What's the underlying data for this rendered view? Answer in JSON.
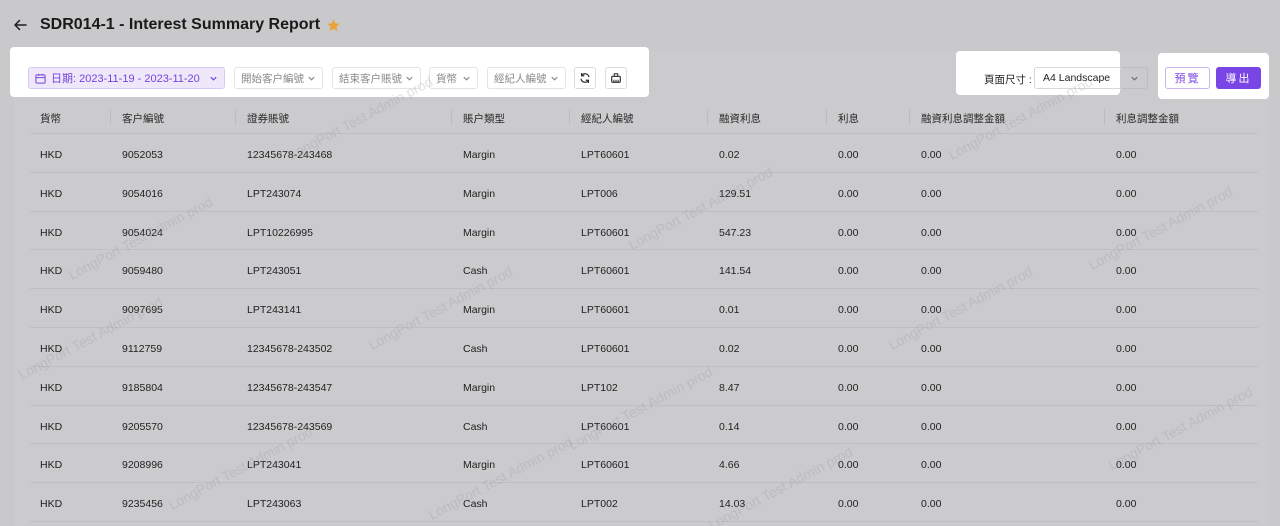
{
  "header": {
    "title": "SDR014-1 - Interest Summary Report"
  },
  "filters": {
    "date_range": "日期: 2023-11-19 - 2023-11-20",
    "start_customer": "開始客户編號",
    "end_customer": "結束客户賬號",
    "currency": "貨幣",
    "broker": "經紀人編號"
  },
  "page_size": {
    "label": "頁面尺寸 :",
    "value": "A4 Landscape"
  },
  "actions": {
    "preview": "預覽",
    "export": "導出"
  },
  "colors": {
    "accent": "#7a45e5",
    "star": "#e8a33a"
  },
  "watermark_text": "LongPort Test Admin prod",
  "table": {
    "columns": [
      "貨幣",
      "客户編號",
      "證券賬號",
      "賬户類型",
      "經紀人編號",
      "融資利息",
      "利息",
      "融資利息調整金額",
      "利息調整金額"
    ],
    "rows": [
      [
        "HKD",
        "9052053",
        "12345678-243468",
        "Margin",
        "LPT60601",
        "0.02",
        "0.00",
        "0.00",
        "0.00"
      ],
      [
        "HKD",
        "9054016",
        "LPT243074",
        "Margin",
        "LPT006",
        "129.51",
        "0.00",
        "0.00",
        "0.00"
      ],
      [
        "HKD",
        "9054024",
        "LPT10226995",
        "Margin",
        "LPT60601",
        "547.23",
        "0.00",
        "0.00",
        "0.00"
      ],
      [
        "HKD",
        "9059480",
        "LPT243051",
        "Cash",
        "LPT60601",
        "141.54",
        "0.00",
        "0.00",
        "0.00"
      ],
      [
        "HKD",
        "9097695",
        "LPT243141",
        "Margin",
        "LPT60601",
        "0.01",
        "0.00",
        "0.00",
        "0.00"
      ],
      [
        "HKD",
        "9112759",
        "12345678-243502",
        "Cash",
        "LPT60601",
        "0.02",
        "0.00",
        "0.00",
        "0.00"
      ],
      [
        "HKD",
        "9185804",
        "12345678-243547",
        "Margin",
        "LPT102",
        "8.47",
        "0.00",
        "0.00",
        "0.00"
      ],
      [
        "HKD",
        "9205570",
        "12345678-243569",
        "Cash",
        "LPT60601",
        "0.14",
        "0.00",
        "0.00",
        "0.00"
      ],
      [
        "HKD",
        "9208996",
        "LPT243041",
        "Margin",
        "LPT60601",
        "4.66",
        "0.00",
        "0.00",
        "0.00"
      ],
      [
        "HKD",
        "9235456",
        "LPT243063",
        "Cash",
        "LPT002",
        "14.03",
        "0.00",
        "0.00",
        "0.00"
      ]
    ]
  }
}
